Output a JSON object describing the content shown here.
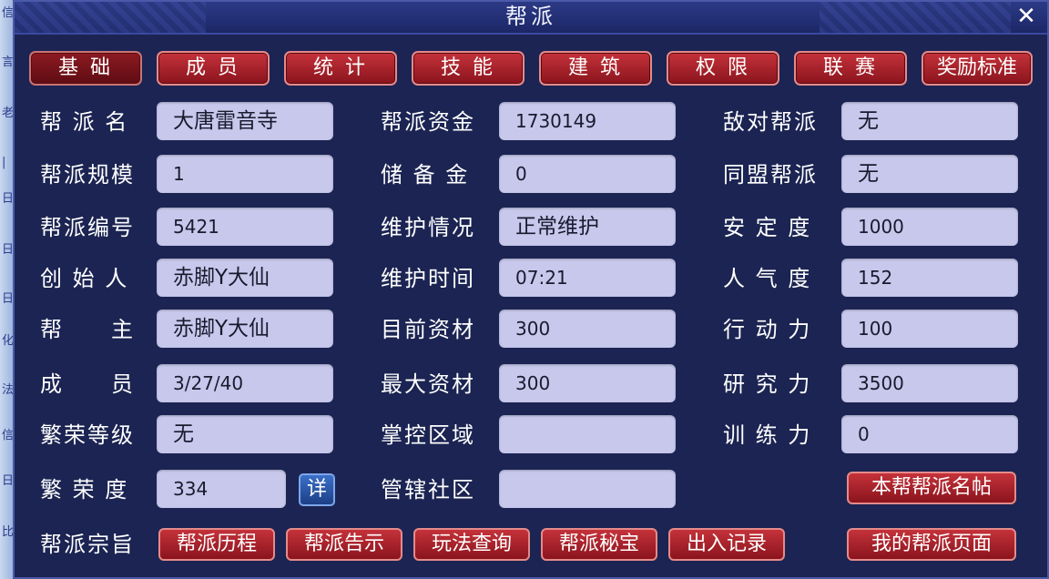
{
  "window": {
    "title": "帮派",
    "close_glyph": "✕"
  },
  "left_strip": [
    "信",
    "言",
    "老",
    "|",
    "日",
    "日",
    "日",
    "化",
    "法",
    "信",
    "日",
    "比"
  ],
  "tabs": [
    {
      "label": "基 础",
      "active": true
    },
    {
      "label": "成 员"
    },
    {
      "label": "统 计"
    },
    {
      "label": "技 能"
    },
    {
      "label": "建 筑"
    },
    {
      "label": "权 限"
    },
    {
      "label": "联 赛"
    },
    {
      "label": "奖励标准"
    }
  ],
  "col1": [
    {
      "label": "帮 派 名",
      "value": "大唐雷音寺"
    },
    {
      "label": "帮派规模",
      "value": "1"
    },
    {
      "label": "帮派编号",
      "value": "5421"
    },
    {
      "label": "创 始 人",
      "value": "赤脚Y大仙"
    },
    {
      "label": "帮　　主",
      "value": "赤脚Y大仙"
    },
    {
      "label": "成　　员",
      "value": "3/27/40"
    },
    {
      "label": "繁荣等级",
      "value": "无"
    },
    {
      "label": "繁 荣 度",
      "value": "334"
    }
  ],
  "detail_label": "详",
  "col2": [
    {
      "label": "帮派资金",
      "value": "1730149"
    },
    {
      "label": "储 备 金",
      "value": "0"
    },
    {
      "label": "维护情况",
      "value": "正常维护"
    },
    {
      "label": "维护时间",
      "value": "07:21"
    },
    {
      "label": "目前资材",
      "value": "300"
    },
    {
      "label": "最大资材",
      "value": "300"
    },
    {
      "label": "掌控区域",
      "value": ""
    },
    {
      "label": "管辖社区",
      "value": ""
    }
  ],
  "col3": [
    {
      "label": "敌对帮派",
      "value": "无"
    },
    {
      "label": "同盟帮派",
      "value": "无"
    },
    {
      "label": "安 定 度",
      "value": "1000"
    },
    {
      "label": "人 气 度",
      "value": "152"
    },
    {
      "label": "行 动 力",
      "value": "100"
    },
    {
      "label": "研 究 力",
      "value": "3500"
    },
    {
      "label": "训 练 力",
      "value": "0"
    }
  ],
  "card_button": "本帮帮派名帖",
  "bottom": {
    "label": "帮派宗旨",
    "buttons": [
      "帮派历程",
      "帮派告示",
      "玩法查询",
      "帮派秘宝",
      "出入记录"
    ],
    "page_button": "我的帮派页面"
  },
  "colors": {
    "tab_red": "#a8202a",
    "field_bg": "#c7c8ec",
    "panel_bg": "#1b2452"
  }
}
